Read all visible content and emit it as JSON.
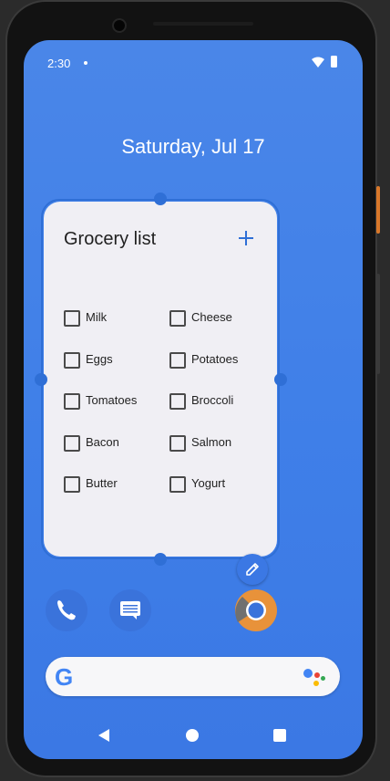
{
  "status_bar": {
    "time": "2:30"
  },
  "date": "Saturday, Jul 17",
  "widget": {
    "title": "Grocery list",
    "items_left": [
      {
        "label": "Milk",
        "checked": false
      },
      {
        "label": "Eggs",
        "checked": false
      },
      {
        "label": "Tomatoes",
        "checked": false
      },
      {
        "label": "Bacon",
        "checked": false
      },
      {
        "label": "Butter",
        "checked": false
      }
    ],
    "items_right": [
      {
        "label": "Cheese",
        "checked": false
      },
      {
        "label": "Potatoes",
        "checked": false
      },
      {
        "label": "Broccoli",
        "checked": false
      },
      {
        "label": "Salmon",
        "checked": false
      },
      {
        "label": "Yogurt",
        "checked": false
      }
    ]
  },
  "dock": {
    "apps": [
      "phone-icon",
      "messages-icon",
      "chrome-icon"
    ]
  },
  "search": {
    "logo": "G"
  },
  "colors": {
    "accent": "#2f6fd6",
    "wallpaper": "#4a86e8",
    "widget_bg": "#f0eff4"
  }
}
